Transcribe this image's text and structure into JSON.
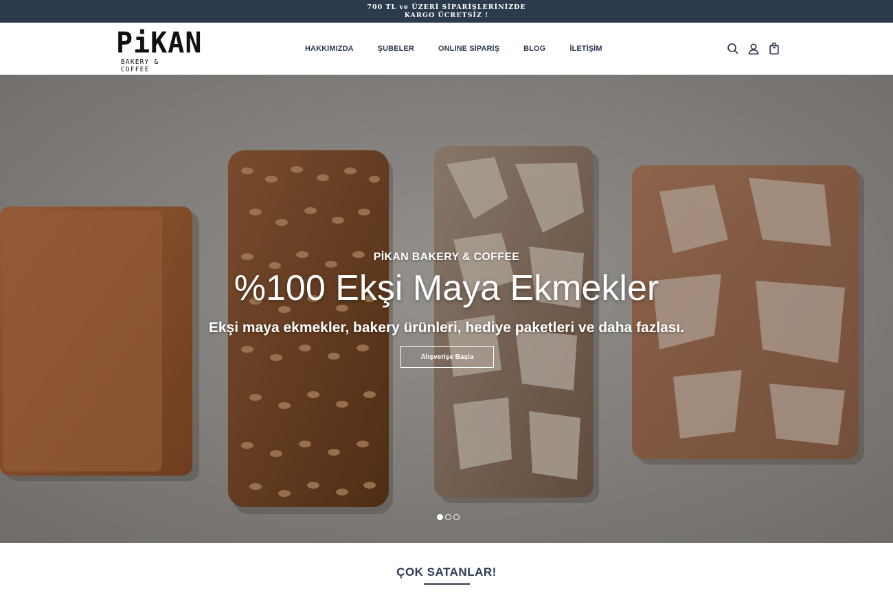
{
  "announcement": {
    "line1": "700 TL ve ÜZERİ SİPARİŞLERİNİZDE",
    "line2": "KARGO ÜCRETSİZ !"
  },
  "brand": {
    "name": "PiKAN",
    "tagline": "BAKERY & COFFEE"
  },
  "nav": {
    "items": [
      {
        "label": "HAKKIMIZDA"
      },
      {
        "label": "ŞUBELER"
      },
      {
        "label": "ONLINE SİPARİŞ"
      },
      {
        "label": "BLOG"
      },
      {
        "label": "İLETİŞİM"
      }
    ]
  },
  "header_icons": [
    "search-icon",
    "account-icon",
    "cart-icon"
  ],
  "hero": {
    "kicker": "PİKAN BAKERY & COFFEE",
    "headline": "%100 Ekşi Maya Ekmekler",
    "subline": "Ekşi maya ekmekler, bakery ürünleri, hediye paketleri ve daha fazlası.",
    "cta_label": "Alışverişe Başla",
    "slides_total": 3,
    "active_slide": 1
  },
  "section": {
    "title": "ÇOK SATANLAR!"
  },
  "colors": {
    "navy": "#2c3a4e",
    "white": "#ffffff"
  }
}
